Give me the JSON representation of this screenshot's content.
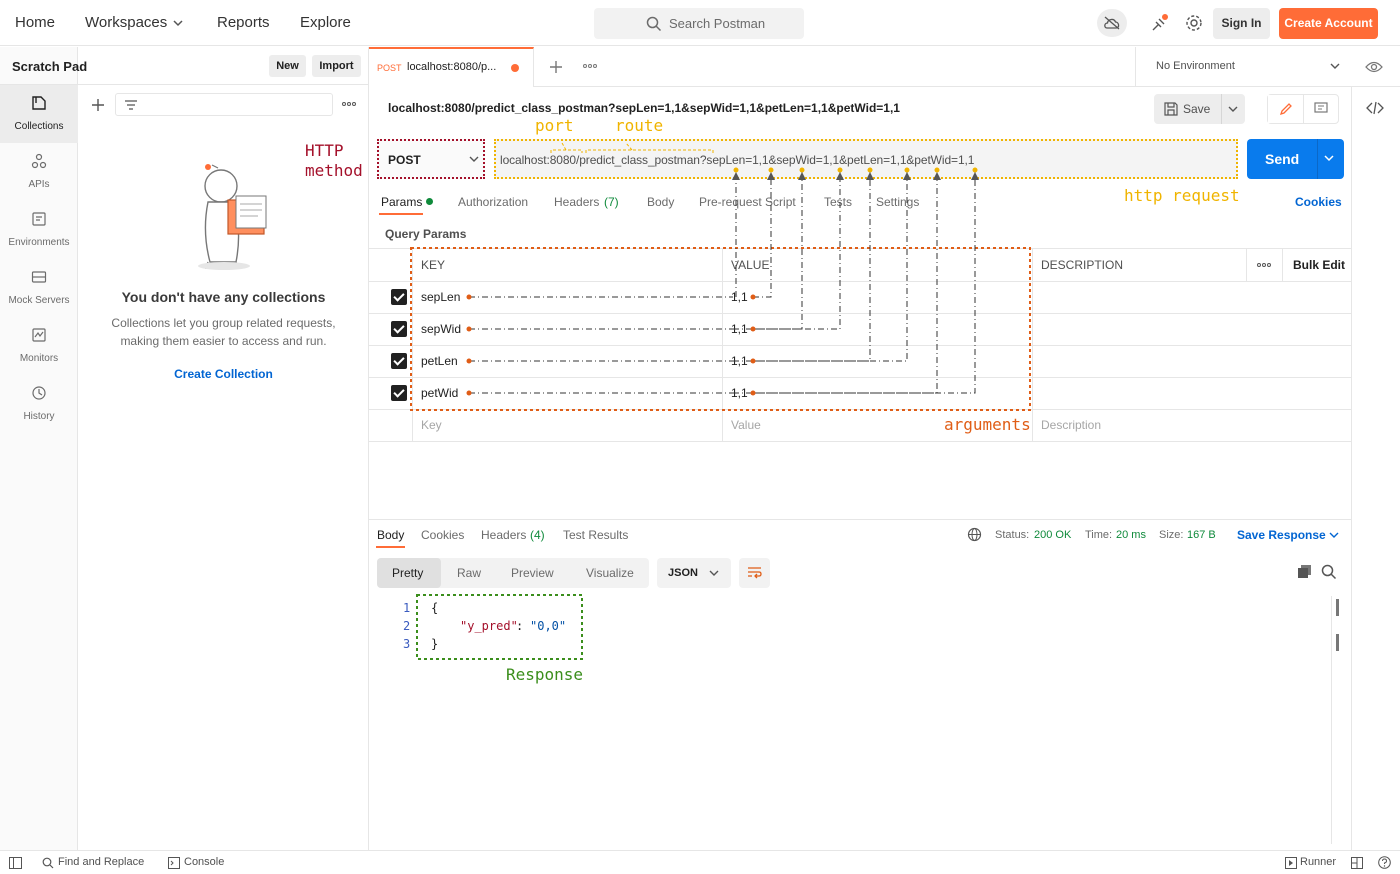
{
  "topbar": {
    "nav": [
      "Home",
      "Workspaces",
      "Reports",
      "Explore"
    ],
    "search_placeholder": "Search Postman",
    "sign_in": "Sign In",
    "create_account": "Create Account"
  },
  "rail": {
    "items": [
      "Collections",
      "APIs",
      "Environments",
      "Mock Servers",
      "Monitors",
      "History"
    ]
  },
  "sidepanel": {
    "title": "Scratch Pad",
    "new_label": "New",
    "import_label": "Import",
    "empty_title": "You don't have any collections",
    "empty_desc_1": "Collections let you group related requests,",
    "empty_desc_2": "making them easier to access and run.",
    "create_link": "Create Collection"
  },
  "tab": {
    "method": "POST",
    "title": "localhost:8080/p...",
    "environment": "No Environment"
  },
  "request": {
    "name": "localhost:8080/predict_class_postman?sepLen=1,1&sepWid=1,1&petLen=1,1&petWid=1,1",
    "save_label": "Save",
    "method": "POST",
    "url": "localhost:8080/predict_class_postman?sepLen=1,1&sepWid=1,1&petLen=1,1&petWid=1,1",
    "send_label": "Send",
    "cookies_label": "Cookies"
  },
  "req_tabs": [
    "Params",
    "Authorization",
    "Headers",
    "(7)",
    "Body",
    "Pre-request Script",
    "Tests",
    "Settings"
  ],
  "params": {
    "section_title": "Query Params",
    "col_key": "KEY",
    "col_value": "VALUE",
    "col_desc": "DESCRIPTION",
    "bulk_edit": "Bulk Edit",
    "rows": [
      {
        "key": "sepLen",
        "value": "1,1"
      },
      {
        "key": "sepWid",
        "value": "1,1"
      },
      {
        "key": "petLen",
        "value": "1,1"
      },
      {
        "key": "petWid",
        "value": "1,1"
      }
    ],
    "key_placeholder": "Key",
    "value_placeholder": "Value",
    "desc_placeholder": "Description"
  },
  "annotations": {
    "http_method_1": "HTTP",
    "http_method_2": "method",
    "port": "port",
    "route": "route",
    "http_request": "http request",
    "arguments": "arguments",
    "response": "Response"
  },
  "response": {
    "tabs": [
      "Body",
      "Cookies",
      "Headers",
      "(4)",
      "Test Results"
    ],
    "status_label": "Status:",
    "status_value": "200 OK",
    "time_label": "Time:",
    "time_value": "20 ms",
    "size_label": "Size:",
    "size_value": "167 B",
    "save_response": "Save Response",
    "view_modes": [
      "Pretty",
      "Raw",
      "Preview",
      "Visualize"
    ],
    "format": "JSON",
    "lines": [
      "1",
      "2",
      "3"
    ],
    "code_open": "{",
    "code_key": "\"y_pred\"",
    "code_colon": ": ",
    "code_value": "\"0,0\"",
    "code_close": "}"
  },
  "bottombar": {
    "find_replace": "Find and Replace",
    "console": "Console",
    "runner": "Runner"
  },
  "colors": {
    "accent_orange": "#ff6c37",
    "send_blue": "#097bed",
    "link_blue": "#0265d2",
    "status_green": "#0f8a3b",
    "method_red": "#a4102a",
    "annot_yellow": "#f0b400",
    "annot_orange": "#e05d16",
    "annot_green": "#3b8e1c"
  }
}
